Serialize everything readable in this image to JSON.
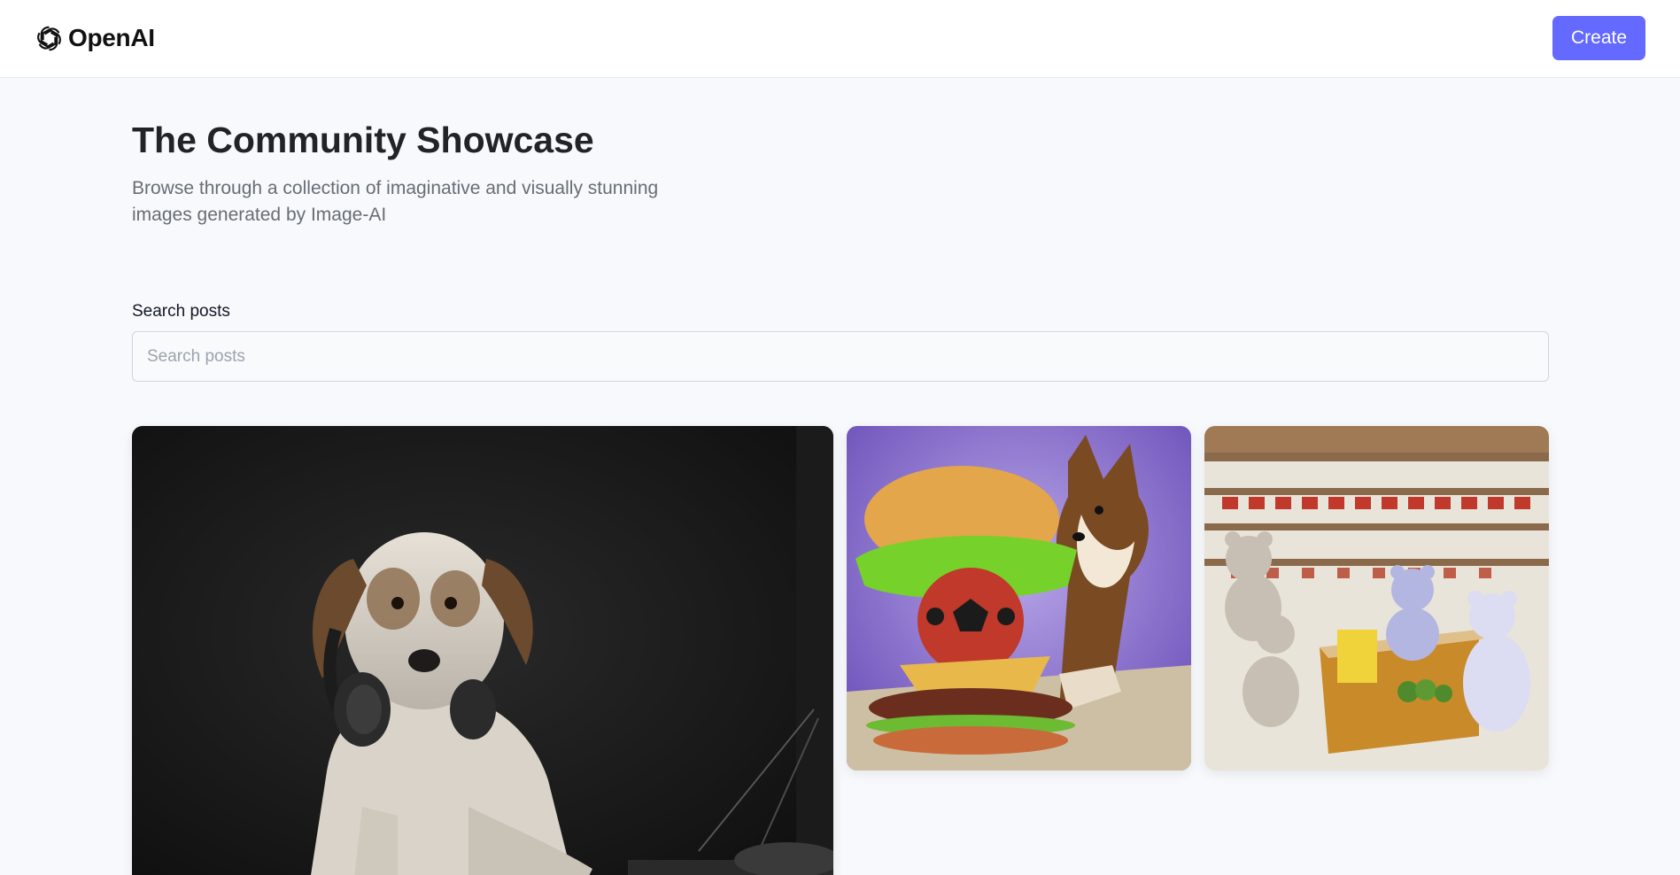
{
  "header": {
    "logo_text": "OpenAI",
    "logo_icon": "openai-logo-icon",
    "create_label": "Create",
    "accent_color": "#6469ff"
  },
  "main": {
    "title": "The Community Showcase",
    "subtitle": "Browse through a collection of imaginative and visually stunning images generated by Image-AI",
    "search": {
      "label": "Search posts",
      "placeholder": "Search posts",
      "value": ""
    },
    "gallery": [
      {
        "image": "dog-with-headphones-image"
      },
      {
        "image": "shiba-inu-with-burger-image"
      },
      {
        "image": "bears-in-grocery-store-image"
      }
    ]
  }
}
